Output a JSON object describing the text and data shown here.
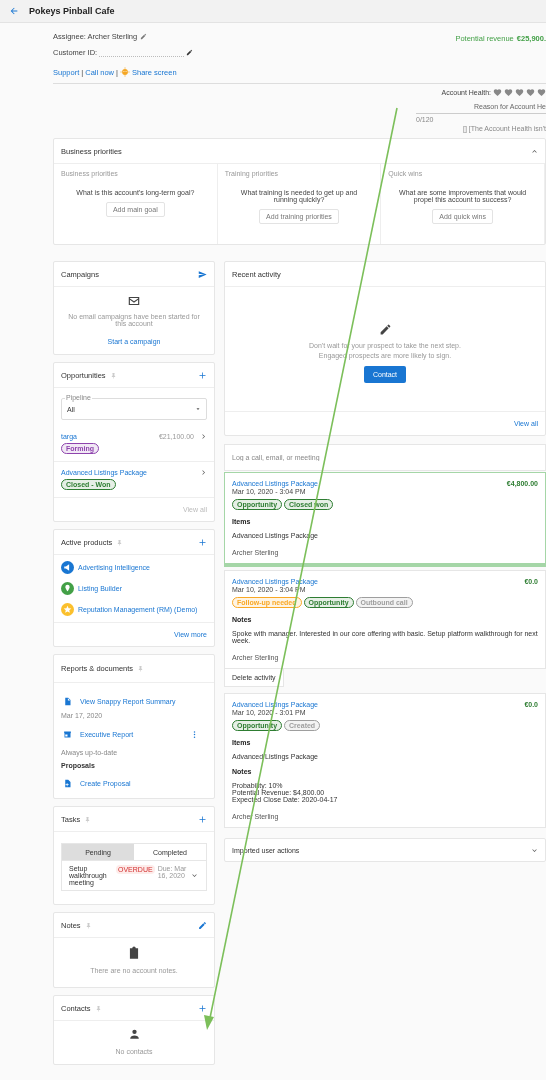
{
  "header": {
    "title": "Pokeys Pinball Cafe"
  },
  "account": {
    "assignee": "Assignee: Archer Sterling",
    "customer_id": "Customer ID:",
    "links": [
      "Support",
      "Call now",
      "Share screen"
    ],
    "separator": "|"
  },
  "revenue": {
    "label": "Potential revenue",
    "amount": "€25,900."
  },
  "health": {
    "label": "Account Health:",
    "reason": "Reason for Account He",
    "reading": "0/120",
    "note": "[] [The Account Health isn't"
  },
  "business_priorities": {
    "title": "Business priorities",
    "expanded": true,
    "columns": [
      {
        "title": "Business priorities",
        "question": "What is this account's long-term goal?",
        "button": "Add main goal"
      },
      {
        "title": "Training priorities",
        "question": "What training is needed to get up and running quickly?",
        "button": "Add training priorities"
      },
      {
        "title": "Quick wins",
        "question": "What are some improvements that would propel this account to success?",
        "button": "Add quick wins"
      }
    ]
  },
  "campaigns": {
    "title": "Campaigns",
    "empty": "No email campaigns have been started for this account",
    "action": "Start a campaign"
  },
  "opportunities": {
    "title": "Opportunities",
    "pipeline_label": "Pipeline",
    "pipeline_value": "All",
    "items": [
      {
        "name": "targa",
        "amount": "€21,100.00",
        "tag": "Forming",
        "color": "#8e44ad"
      },
      {
        "name": "Advanced Listings Package",
        "tag": "Closed - Won",
        "color": "#2e7d32"
      }
    ],
    "view_all": "View all"
  },
  "active_products": {
    "title": "Active products",
    "items": [
      {
        "name": "Advertising Intelligence",
        "kind": "megaphone",
        "color": "#1976d2"
      },
      {
        "name": "Listing Builder",
        "kind": "pin",
        "color": "#43a047"
      },
      {
        "name": "Reputation Management (RM) (Demo)",
        "kind": "star",
        "color": "#fbc02d"
      }
    ],
    "view_more": "View more"
  },
  "reports": {
    "title": "Reports & documents",
    "items": [
      {
        "kind": "document",
        "label": "View Snappy Report Summary",
        "sub": "Mar 17, 2020"
      },
      {
        "kind": "report",
        "label": "Executive Report",
        "sub": "Always up-to-date"
      }
    ],
    "proposals_heading": "Proposals",
    "proposal": "Create Proposal"
  },
  "tasks": {
    "title": "Tasks",
    "tabs": [
      {
        "label": "Pending",
        "selected": true
      },
      {
        "label": "Completed",
        "selected": false
      }
    ],
    "task": {
      "title": "Setup walkthrough meeting",
      "status": "OVERDUE",
      "due": "Due: Mar 16, 2020"
    }
  },
  "notes": {
    "title": "Notes",
    "empty": "There are no account notes."
  },
  "contacts": {
    "title": "Contacts",
    "empty": "No contacts"
  },
  "recent_activity": {
    "title": "Recent activity",
    "prompt": "Don't wait for your prospect to take the next step. Engaged prospects are more likely to sign.",
    "button": "Contact",
    "view_all": "View all"
  },
  "log": {
    "placeholder": "Log a call, email, or meeting"
  },
  "activities": [
    {
      "title": "Advanced Listings Package",
      "date": "Mar 10, 2020 - 3:04 PM",
      "amount": "€4,800.00",
      "highlighted": true,
      "tags": [
        {
          "label": "Opportunity",
          "color": "#2e7d32"
        },
        {
          "label": "Closed won",
          "color": "#2e7d32"
        }
      ],
      "sections": [
        {
          "heading": "Items",
          "lines": [
            "Advanced Listings Package"
          ]
        }
      ],
      "author": "Archer Sterling"
    },
    {
      "title": "Advanced Listings Package",
      "date": "Mar 10, 2020 - 3:04 PM",
      "amount": "€0.0",
      "highlighted": false,
      "tags": [
        {
          "label": "Follow-up needed",
          "color": "#f9a825"
        },
        {
          "label": "Opportunity",
          "color": "#2e7d32"
        },
        {
          "label": "Outbound call",
          "color": "#9e9e9e"
        }
      ],
      "sections": [
        {
          "heading": "Notes",
          "lines": [
            "Spoke with manager. Interested in our core offering with basic. Setup platform walkthrough for next week."
          ]
        }
      ],
      "author": "Archer Sterling",
      "action": "Delete activity"
    },
    {
      "title": "Advanced Listings Package",
      "date": "Mar 10, 2020 - 3:01 PM",
      "amount": "€0.0",
      "highlighted": false,
      "tags": [
        {
          "label": "Opportunity",
          "color": "#2e7d32"
        },
        {
          "label": "Created",
          "color": "#9e9e9e"
        }
      ],
      "sections": [
        {
          "heading": "Items",
          "lines": [
            "Advanced Listings Package"
          ]
        },
        {
          "heading": "Notes",
          "lines": [
            "Probability: 10%",
            "Potential Revenue: $4,800.00",
            "Expected Close Date: 2020-04-17"
          ]
        }
      ],
      "author": "Archer Sterling"
    }
  ],
  "imported": {
    "title": "Imported user actions",
    "expanded": false
  }
}
